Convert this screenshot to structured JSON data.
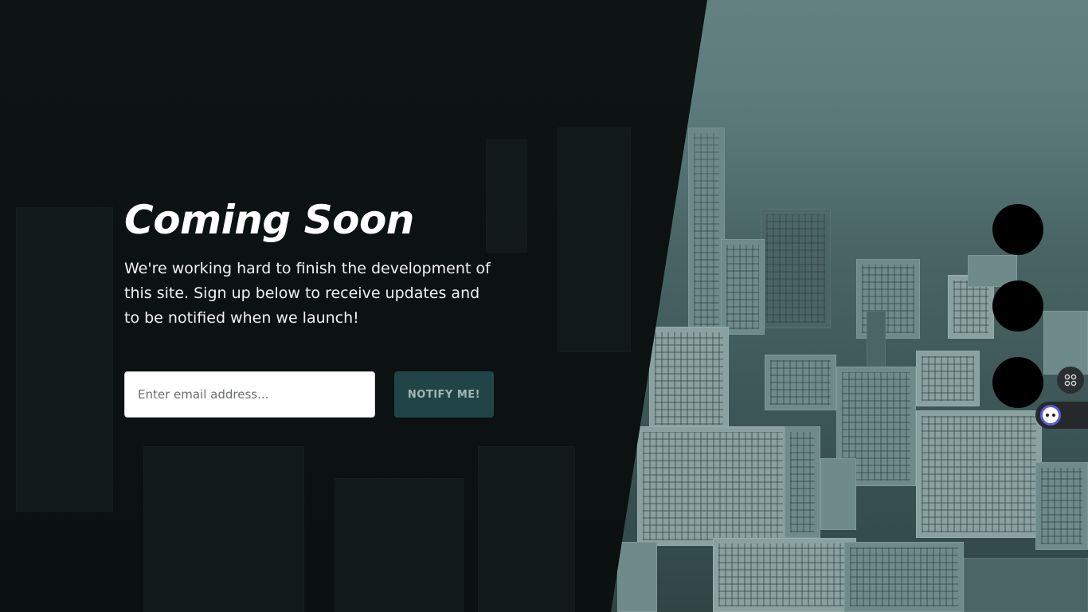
{
  "hero": {
    "title": "Coming Soon",
    "description": "We're working hard to finish the development of this site. Sign up below to receive updates and to be notified when we launch!"
  },
  "signup": {
    "email_placeholder": "Enter email address...",
    "email_value": "",
    "button_label": "NOTIFY ME!"
  },
  "social": {
    "items": [
      "social-link-1",
      "social-link-2",
      "social-link-3"
    ]
  },
  "widgets": {
    "grid_icon": "grid-icon",
    "assistant_icon": "chatbot-icon"
  },
  "colors": {
    "panel": "#0e1414",
    "button_bg": "#214546",
    "button_text": "#9fb6b5",
    "accent_purple": "#5b5bd6"
  }
}
